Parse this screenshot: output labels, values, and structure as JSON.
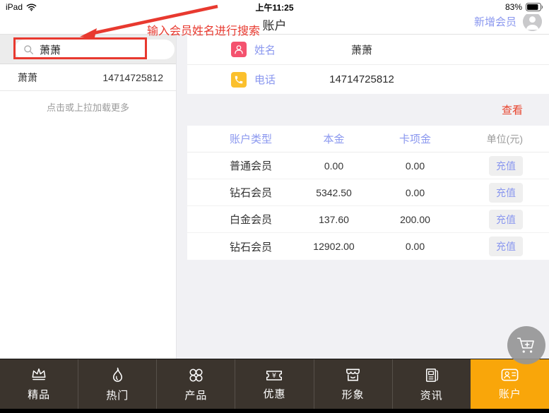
{
  "status_bar": {
    "device": "iPad",
    "time": "上午11:25",
    "battery_percent": "83%"
  },
  "header": {
    "title": "账户",
    "add_member_label": "新增会员"
  },
  "annotation": {
    "label": "输入会员姓名进行搜索"
  },
  "search": {
    "query": "萧萧"
  },
  "member_list": {
    "items": [
      {
        "name": "萧萧",
        "phone": "14714725812"
      }
    ],
    "load_more": "点击或上拉加载更多"
  },
  "member_detail": {
    "fields": [
      {
        "label": "姓名",
        "value": "萧萧",
        "icon": "person-icon"
      },
      {
        "label": "电话",
        "value": "14714725812",
        "icon": "phone-icon"
      }
    ],
    "view_link": "查看"
  },
  "accounts": {
    "columns": [
      "账户类型",
      "本金",
      "卡项金"
    ],
    "unit_label": "单位(元)",
    "recharge_label": "充值",
    "rows": [
      {
        "type": "普通会员",
        "principal": "0.00",
        "card_amount": "0.00"
      },
      {
        "type": "钻石会员",
        "principal": "5342.50",
        "card_amount": "0.00"
      },
      {
        "type": "白金会员",
        "principal": "137.60",
        "card_amount": "200.00"
      },
      {
        "type": "钻石会员",
        "principal": "12902.00",
        "card_amount": "0.00"
      }
    ]
  },
  "nav": {
    "items": [
      {
        "label": "精品",
        "icon": "crown-icon",
        "active": false
      },
      {
        "label": "热门",
        "icon": "flame-icon",
        "active": false
      },
      {
        "label": "产品",
        "icon": "grid-circles-icon",
        "active": false
      },
      {
        "label": "优惠",
        "icon": "coupon-icon",
        "active": false
      },
      {
        "label": "形象",
        "icon": "storefront-icon",
        "active": false
      },
      {
        "label": "资讯",
        "icon": "news-icon",
        "active": false
      },
      {
        "label": "账户",
        "icon": "id-card-icon",
        "active": true
      }
    ]
  },
  "colors": {
    "accent_orange": "#f9a60a",
    "label_blue": "#8a97ef",
    "annotation_red": "#e8392f",
    "icon_pink": "#f4526e",
    "icon_amber": "#fbc02d",
    "view_link_red": "#e8432c",
    "nav_background": "#3b342d"
  }
}
